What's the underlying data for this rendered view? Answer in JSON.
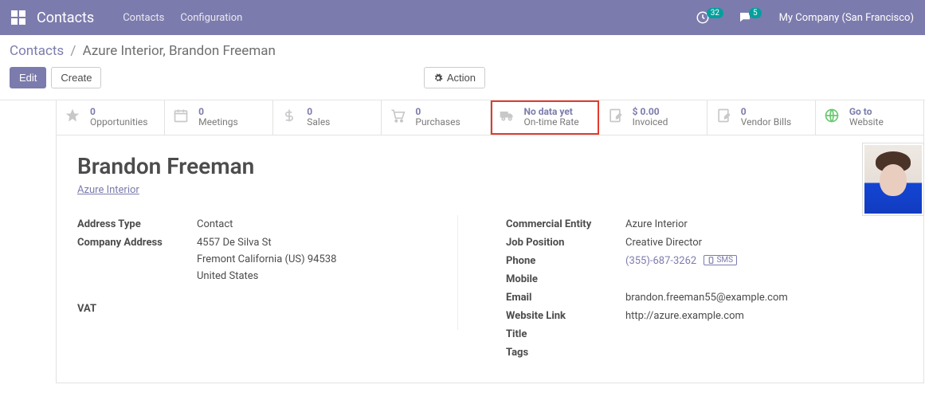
{
  "topbar": {
    "app_title": "Contacts",
    "nav": [
      "Contacts",
      "Configuration"
    ],
    "clock_count": "32",
    "msg_count": "5",
    "company": "My Company (San Francisco)"
  },
  "breadcrumb": {
    "root": "Contacts",
    "current": "Azure Interior, Brandon Freeman"
  },
  "buttons": {
    "edit": "Edit",
    "create": "Create",
    "action": "Action"
  },
  "stats": [
    {
      "icon": "star-icon",
      "value": "0",
      "label": "Opportunities"
    },
    {
      "icon": "calendar-icon",
      "value": "0",
      "label": "Meetings"
    },
    {
      "icon": "dollar-icon",
      "value": "0",
      "label": "Sales"
    },
    {
      "icon": "cart-icon",
      "value": "0",
      "label": "Purchases"
    },
    {
      "icon": "truck-icon",
      "value": "No data yet",
      "label": "On-time Rate",
      "highlight": true
    },
    {
      "icon": "pencil-icon",
      "value": "$ 0.00",
      "label": "Invoiced"
    },
    {
      "icon": "pencil-icon",
      "value": "0",
      "label": "Vendor Bills"
    },
    {
      "icon": "globe-icon",
      "value": "Go to",
      "label": "Website"
    }
  ],
  "record": {
    "name": "Brandon Freeman",
    "parent_company": "Azure Interior"
  },
  "left_fields": {
    "address_type": {
      "label": "Address Type",
      "value": "Contact"
    },
    "company_addr": {
      "label": "Company Address",
      "line1": "4557 De Silva St",
      "line2": "Fremont  California (US)  94538",
      "line3": "United States"
    },
    "vat": {
      "label": "VAT",
      "value": ""
    }
  },
  "right_fields": {
    "commercial": {
      "label": "Commercial Entity",
      "value": "Azure Interior"
    },
    "job": {
      "label": "Job Position",
      "value": "Creative Director"
    },
    "phone": {
      "label": "Phone",
      "value": "(355)-687-3262",
      "sms": "SMS"
    },
    "mobile": {
      "label": "Mobile",
      "value": ""
    },
    "email": {
      "label": "Email",
      "value": "brandon.freeman55@example.com"
    },
    "website": {
      "label": "Website Link",
      "value": "http://azure.example.com"
    },
    "title": {
      "label": "Title",
      "value": ""
    },
    "tags": {
      "label": "Tags",
      "value": ""
    }
  }
}
